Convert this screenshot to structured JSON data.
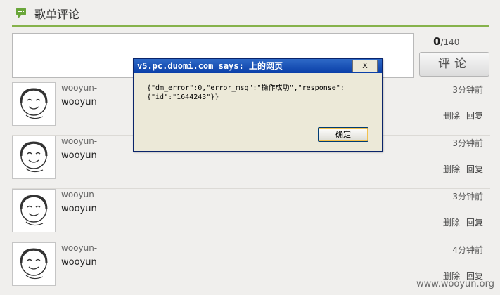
{
  "header": {
    "title": "歌单评论",
    "icon": "comment-icon"
  },
  "editor": {
    "placeholder": "",
    "value": "",
    "counter_current": "0",
    "counter_max": "/140",
    "submit_label": "评论"
  },
  "comments": [
    {
      "name": "wooyun-",
      "text": "wooyun",
      "time": "3分钟前",
      "delete_label": "删除",
      "reply_label": "回复"
    },
    {
      "name": "wooyun-",
      "text": "wooyun",
      "time": "3分钟前",
      "delete_label": "删除",
      "reply_label": "回复"
    },
    {
      "name": "wooyun-",
      "text": "wooyun",
      "time": "3分钟前",
      "delete_label": "删除",
      "reply_label": "回复"
    },
    {
      "name": "wooyun-",
      "text": "wooyun",
      "time": "4分钟前",
      "delete_label": "删除",
      "reply_label": "回复"
    }
  ],
  "dialog": {
    "title": "v5.pc.duomi.com says: 上的网页",
    "close_label": "X",
    "message": "{\"dm_error\":0,\"error_msg\":\"操作成功\",\"response\":\n{\"id\":\"1644243\"}}",
    "ok_label": "确定"
  },
  "watermark": "www.wooyun.org",
  "colors": {
    "accent": "#86b24b",
    "dialog_title": "#0a3fa8",
    "dialog_bg": "#ece9d8"
  }
}
